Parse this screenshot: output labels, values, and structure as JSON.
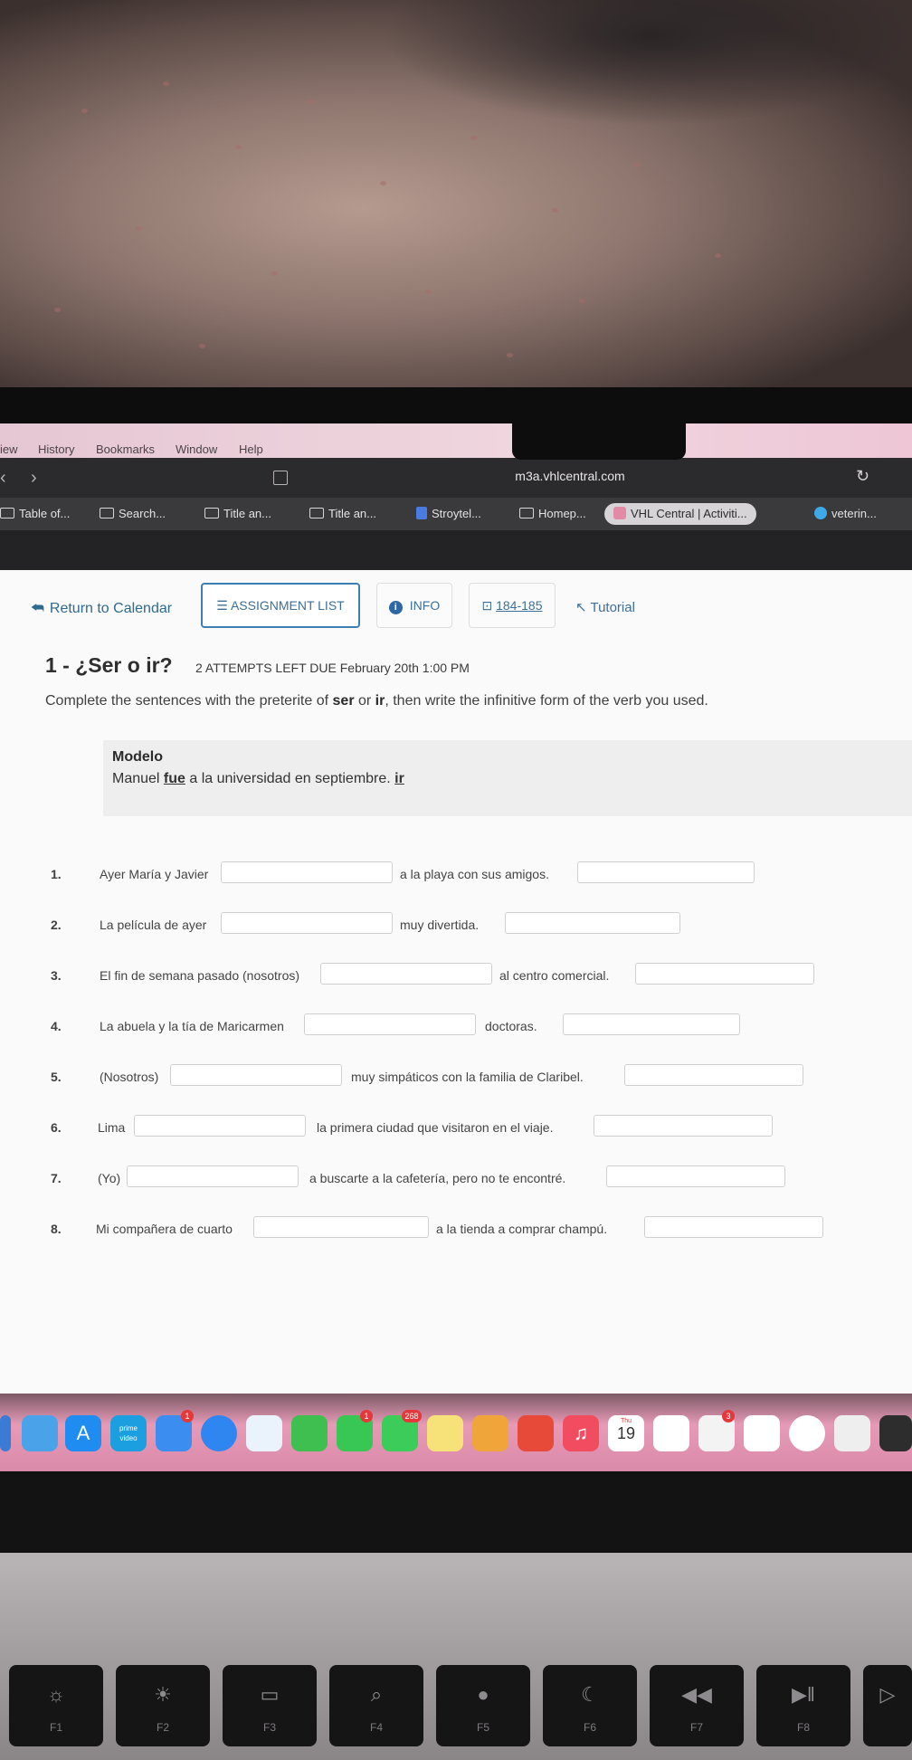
{
  "menubar": [
    "iew",
    "History",
    "Bookmarks",
    "Window",
    "Help"
  ],
  "toolbar": {
    "url": "m3a.vhlcentral.com"
  },
  "tabs": [
    "Table of...",
    "Search...",
    "Title an...",
    "Title an...",
    "Stroytel...",
    "Homep...",
    "VHL Central | Activiti...",
    "veterin..."
  ],
  "nav": {
    "return": "Return to Calendar",
    "assignment_list": "ASSIGNMENT LIST",
    "info": "INFO",
    "pages": "184-185",
    "tutorial": "Tutorial"
  },
  "activity": {
    "title": "1 - ¿Ser o ir?",
    "meta": "2 ATTEMPTS LEFT   DUE  February 20th 1:00 PM",
    "instr_a": "Complete the sentences with the preterite of ",
    "instr_ser": "ser",
    "instr_or": " or ",
    "instr_ir": "ir",
    "instr_b": ", then write the infinitive form of the verb you used."
  },
  "modelo": {
    "heading": "Modelo",
    "pre": "Manuel ",
    "verb": "fue",
    "post": " a la universidad en septiembre. ",
    "infinitive": "ir"
  },
  "questions": [
    {
      "num": "1.",
      "before": "Ayer María y Javier",
      "after": "a la playa con sus amigos."
    },
    {
      "num": "2.",
      "before": "La película de ayer",
      "after": "muy divertida."
    },
    {
      "num": "3.",
      "before": "El fin de semana pasado (nosotros)",
      "after": "al centro comercial."
    },
    {
      "num": "4.",
      "before": "La abuela y la tía de Maricarmen",
      "after": "doctoras."
    },
    {
      "num": "5.",
      "before": "(Nosotros)",
      "after": "muy simpáticos con la familia de Claribel."
    },
    {
      "num": "6.",
      "before": "Lima",
      "after": "la primera ciudad que visitaron en el viaje."
    },
    {
      "num": "7.",
      "before": "(Yo)",
      "after": "a buscarte a la cafetería, pero no te encontré."
    },
    {
      "num": "8.",
      "before": "Mi compañera de cuarto",
      "after": "a la tienda a comprar champú."
    }
  ],
  "dock": {
    "calendar_day": "19",
    "calendar_month": "Thu",
    "badge_mail": "1",
    "badge_facetime": "1",
    "badge_messages": "268",
    "badge_reminders": "3",
    "prime_label": "prime video"
  },
  "keys": [
    {
      "label": "F1",
      "icon": "brightness-down-icon"
    },
    {
      "label": "F2",
      "icon": "brightness-up-icon"
    },
    {
      "label": "F3",
      "icon": "mission-control-icon"
    },
    {
      "label": "F4",
      "icon": "search-icon"
    },
    {
      "label": "F5",
      "icon": "dictation-icon"
    },
    {
      "label": "F6",
      "icon": "do-not-disturb-icon"
    },
    {
      "label": "F7",
      "icon": "rewind-icon"
    },
    {
      "label": "F8",
      "icon": "play-pause-icon"
    }
  ]
}
